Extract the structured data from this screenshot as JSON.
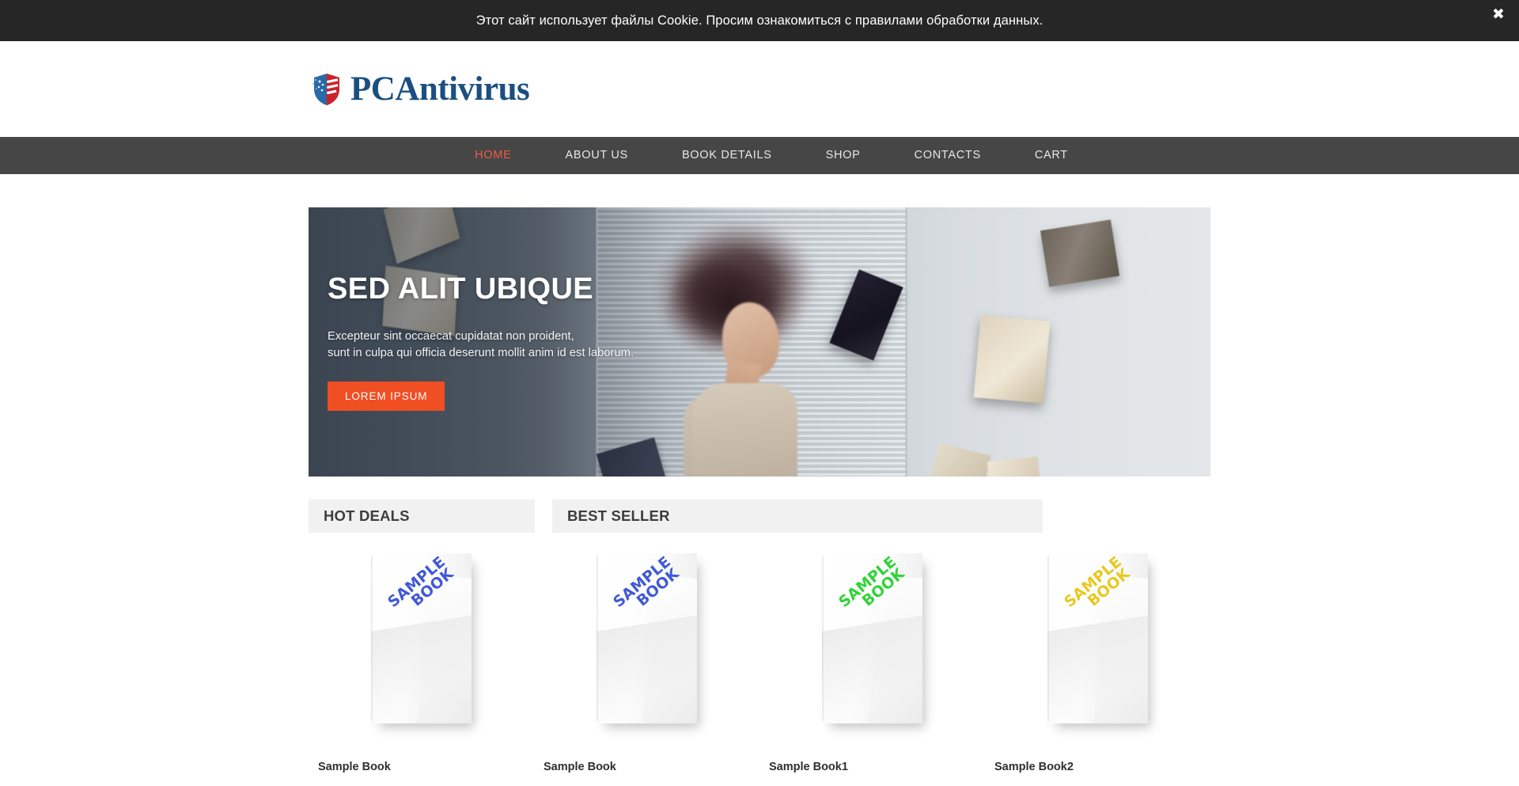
{
  "cookie_bar": {
    "message": "Этот сайт использует файлы Cookie. Просим ознакомиться с правилами обработки данных.",
    "close_glyph": "✖",
    "background_color": "#262626"
  },
  "header": {
    "logo_text": "PCAntivirus",
    "logo_color": "#1b4f80",
    "shield_blue": "#2a6aa8",
    "shield_red": "#cc2229"
  },
  "nav": {
    "background_color": "#464646",
    "active_color": "#ef5b43",
    "items": [
      {
        "label": "HOME",
        "active": true
      },
      {
        "label": "ABOUT US",
        "active": false
      },
      {
        "label": "BOOK DETAILS",
        "active": false
      },
      {
        "label": "SHOP",
        "active": false
      },
      {
        "label": "CONTACTS",
        "active": false
      },
      {
        "label": "CART",
        "active": false
      }
    ]
  },
  "hero": {
    "title": "SED ALIT UBIQUE",
    "subtitle_line1": "Excepteur sint occaecat cupidatat non proident,",
    "subtitle_line2": "sunt in culpa qui officia deserunt mollit anim id est laborum.",
    "button_label": "LOREM IPSUM",
    "button_color": "#f04e23"
  },
  "sections": [
    {
      "title": "HOT DEALS"
    },
    {
      "title": "BEST SELLER"
    }
  ],
  "products": [
    {
      "title": "Sample Book",
      "cover_line1": "SAMPLE",
      "cover_line2": "BOOK",
      "cover_color": "#4158d6"
    },
    {
      "title": "Sample Book",
      "cover_line1": "SAMPLE",
      "cover_line2": "BOOK",
      "cover_color": "#4158d6"
    },
    {
      "title": "Sample Book1",
      "cover_line1": "SAMPLE",
      "cover_line2": "BOOK",
      "cover_color": "#2fd337"
    },
    {
      "title": "Sample Book2",
      "cover_line1": "SAMPLE",
      "cover_line2": "BOOK",
      "cover_color": "#e8c820"
    }
  ]
}
